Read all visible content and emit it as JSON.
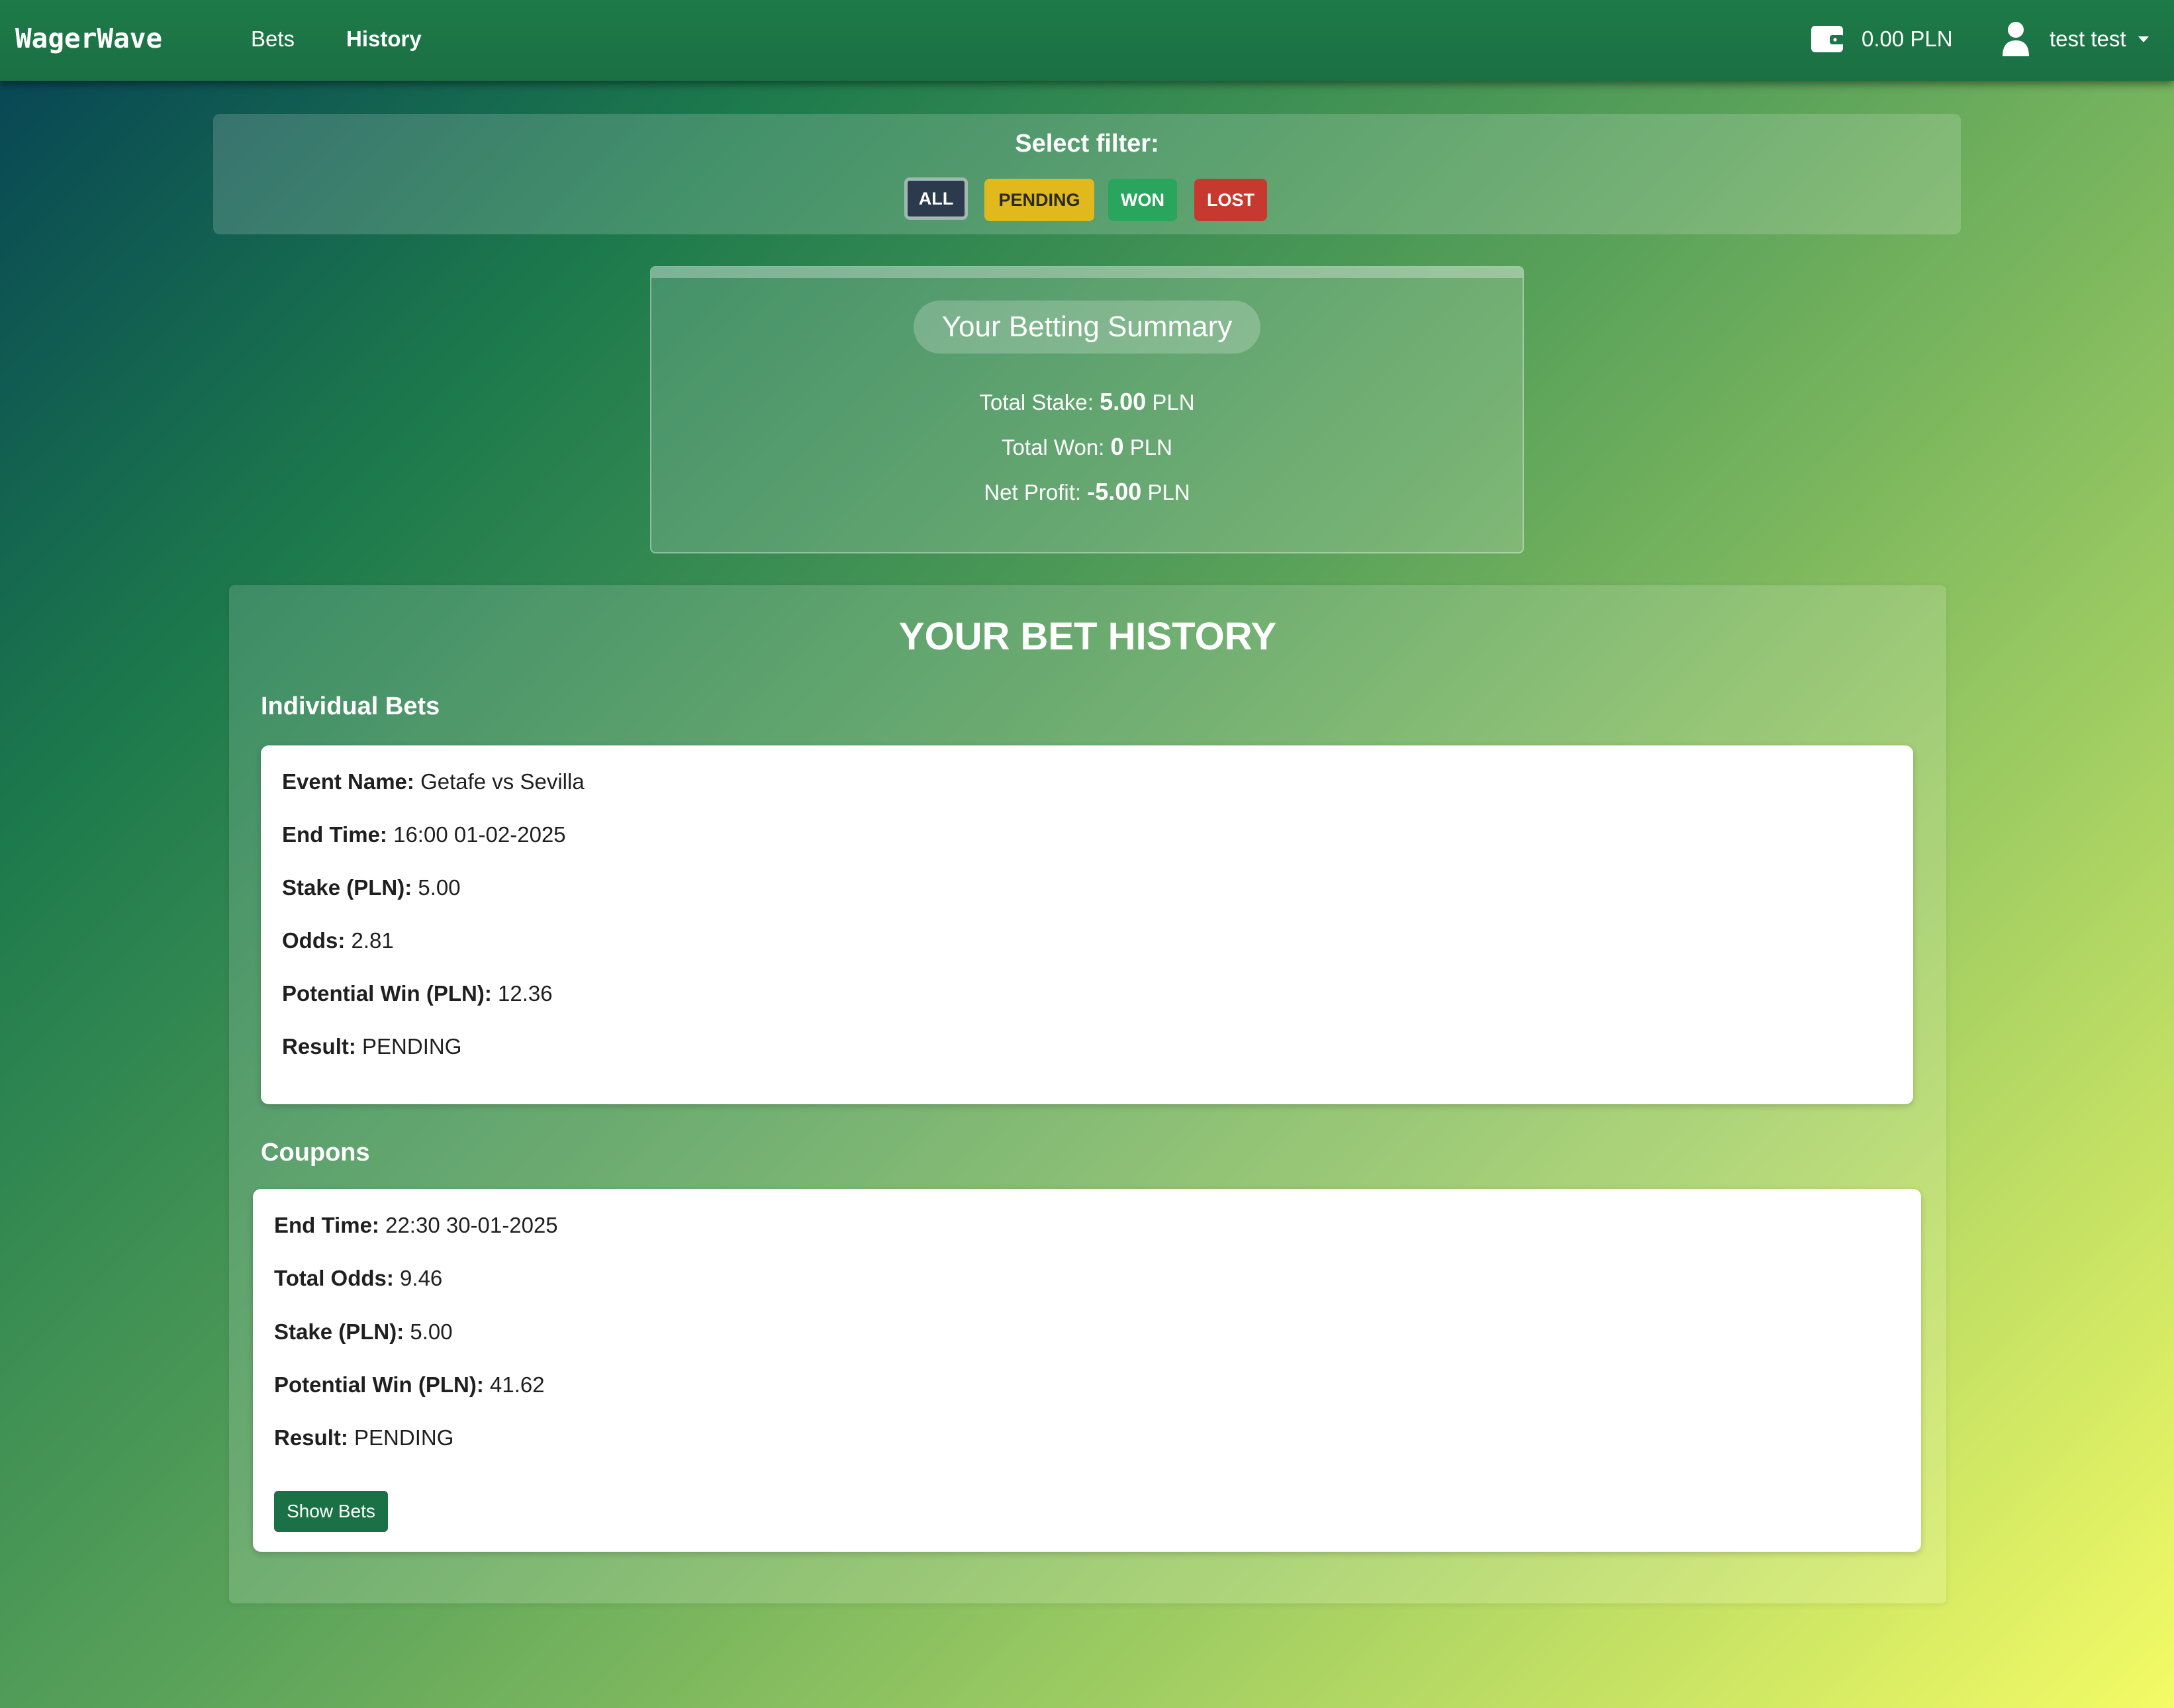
{
  "navbar": {
    "brand": "WagerWave",
    "links": [
      "Bets",
      "History"
    ],
    "active_link": "History",
    "wallet_icon": "wallet-icon",
    "balance": "0.00 PLN",
    "user_icon": "user-icon",
    "user_name": "test test"
  },
  "filter": {
    "title": "Select filter:",
    "buttons": [
      "ALL",
      "PENDING",
      "WON",
      "LOST"
    ],
    "selected": "ALL",
    "colors": {
      "all": "#2b3a4d",
      "pending": "#e1b91c",
      "won": "#2aa55d",
      "lost": "#c7392f"
    }
  },
  "summary": {
    "title": "Your Betting Summary",
    "total_stake_label": "Total Stake:",
    "total_stake_value": "5.00",
    "total_won_label": "Total Won:",
    "total_won_value": "0",
    "net_profit_label": "Net Profit:",
    "net_profit_value": "-5.00",
    "currency": "PLN"
  },
  "history": {
    "title": "YOUR BET HISTORY",
    "individual_title": "Individual Bets",
    "individual_bets": [
      {
        "fields": [
          {
            "label": "Event Name:",
            "value": "Getafe vs Sevilla"
          },
          {
            "label": "End Time:",
            "value": "16:00 01-02-2025"
          },
          {
            "label": "Stake (PLN):",
            "value": "5.00"
          },
          {
            "label": "Odds:",
            "value": "2.81"
          },
          {
            "label": "Potential Win (PLN):",
            "value": "12.36"
          },
          {
            "label": "Result:",
            "value": "PENDING"
          }
        ]
      }
    ],
    "coupons_title": "Coupons",
    "coupons": [
      {
        "fields": [
          {
            "label": "End Time:",
            "value": "22:30 30-01-2025"
          },
          {
            "label": "Total Odds:",
            "value": "9.46"
          },
          {
            "label": "Stake (PLN):",
            "value": "5.00"
          },
          {
            "label": "Potential Win (PLN):",
            "value": "41.62"
          },
          {
            "label": "Result:",
            "value": "PENDING"
          }
        ],
        "button_label": "Show Bets"
      }
    ]
  }
}
